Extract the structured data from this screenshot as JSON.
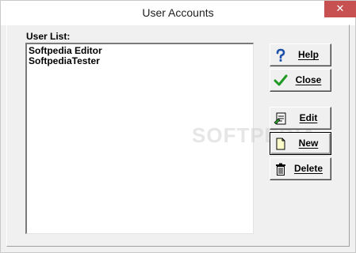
{
  "window": {
    "title": "User Accounts",
    "close_glyph": "✕"
  },
  "user_list": {
    "label": "User List:",
    "items": [
      "Softpedia Editor",
      "SoftpediaTester"
    ]
  },
  "buttons": {
    "help": {
      "label": "Help",
      "icon": "question-icon"
    },
    "close": {
      "label": "Close",
      "icon": "checkmark-icon"
    },
    "edit": {
      "label": "Edit",
      "icon": "edit-document-icon"
    },
    "new": {
      "label": "New",
      "icon": "new-document-icon"
    },
    "delete": {
      "label": "Delete",
      "icon": "trash-icon"
    }
  },
  "watermark": "SOFTPEDIA",
  "colors": {
    "close_button_bg": "#c75050",
    "help_icon": "#1c4fa8",
    "check_icon": "#1f9a24"
  }
}
